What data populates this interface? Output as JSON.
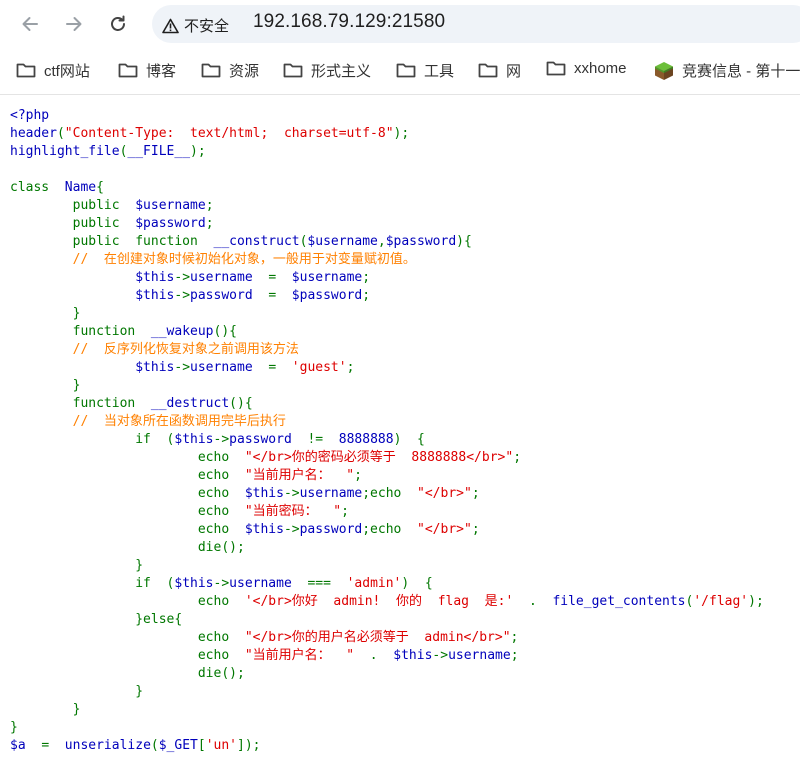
{
  "browser": {
    "security_label": "不安全",
    "url": "192.168.79.129:21580"
  },
  "bookmarks": [
    {
      "label": "ctf网站"
    },
    {
      "label": "博客"
    },
    {
      "label": "资源"
    },
    {
      "label": "形式主义"
    },
    {
      "label": "工具"
    },
    {
      "label": "网"
    },
    {
      "label": "xxhome"
    },
    {
      "label": "竞赛信息 - 第十一"
    }
  ],
  "code_lines": [
    [
      {
        "t": "<?php",
        "c": "b"
      }
    ],
    [
      {
        "t": "header",
        "c": "b"
      },
      {
        "t": "(",
        "c": "k"
      },
      {
        "t": "\"Content-Type:  text/html;  charset=utf-8\"",
        "c": "s"
      },
      {
        "t": ");",
        "c": "k"
      }
    ],
    [
      {
        "t": "highlight_file",
        "c": "b"
      },
      {
        "t": "(",
        "c": "k"
      },
      {
        "t": "__FILE__",
        "c": "b"
      },
      {
        "t": ");",
        "c": "k"
      }
    ],
    [],
    [
      {
        "t": "class  ",
        "c": "k"
      },
      {
        "t": "Name",
        "c": "b"
      },
      {
        "t": "{",
        "c": "k"
      }
    ],
    [
      {
        "t": "        public  ",
        "c": "k"
      },
      {
        "t": "$username",
        "c": "b"
      },
      {
        "t": ";",
        "c": "k"
      }
    ],
    [
      {
        "t": "        public  ",
        "c": "k"
      },
      {
        "t": "$password",
        "c": "b"
      },
      {
        "t": ";",
        "c": "k"
      }
    ],
    [
      {
        "t": "        public  function  ",
        "c": "k"
      },
      {
        "t": "__construct",
        "c": "b"
      },
      {
        "t": "(",
        "c": "k"
      },
      {
        "t": "$username",
        "c": "b"
      },
      {
        "t": ",",
        "c": "k"
      },
      {
        "t": "$password",
        "c": "b"
      },
      {
        "t": "){",
        "c": "k"
      }
    ],
    [
      {
        "t": "        //  在创建对象时候初始化对象，一般用于对变量赋初值。",
        "c": "c"
      }
    ],
    [
      {
        "t": "                ",
        "c": "k"
      },
      {
        "t": "$this",
        "c": "b"
      },
      {
        "t": "->",
        "c": "k"
      },
      {
        "t": "username  ",
        "c": "b"
      },
      {
        "t": "=  ",
        "c": "k"
      },
      {
        "t": "$username",
        "c": "b"
      },
      {
        "t": ";",
        "c": "k"
      }
    ],
    [
      {
        "t": "                ",
        "c": "k"
      },
      {
        "t": "$this",
        "c": "b"
      },
      {
        "t": "->",
        "c": "k"
      },
      {
        "t": "password  ",
        "c": "b"
      },
      {
        "t": "=  ",
        "c": "k"
      },
      {
        "t": "$password",
        "c": "b"
      },
      {
        "t": ";",
        "c": "k"
      }
    ],
    [
      {
        "t": "        }",
        "c": "k"
      }
    ],
    [
      {
        "t": "        function  ",
        "c": "k"
      },
      {
        "t": "__wakeup",
        "c": "b"
      },
      {
        "t": "(){",
        "c": "k"
      }
    ],
    [
      {
        "t": "        //  反序列化恢复对象之前调用该方法",
        "c": "c"
      }
    ],
    [
      {
        "t": "                ",
        "c": "k"
      },
      {
        "t": "$this",
        "c": "b"
      },
      {
        "t": "->",
        "c": "k"
      },
      {
        "t": "username  ",
        "c": "b"
      },
      {
        "t": "=  ",
        "c": "k"
      },
      {
        "t": "'guest'",
        "c": "s"
      },
      {
        "t": ";",
        "c": "k"
      }
    ],
    [
      {
        "t": "        }",
        "c": "k"
      }
    ],
    [
      {
        "t": "        function  ",
        "c": "k"
      },
      {
        "t": "__destruct",
        "c": "b"
      },
      {
        "t": "(){",
        "c": "k"
      }
    ],
    [
      {
        "t": "        //  当对象所在函数调用完毕后执行",
        "c": "c"
      }
    ],
    [
      {
        "t": "                if  (",
        "c": "k"
      },
      {
        "t": "$this",
        "c": "b"
      },
      {
        "t": "->",
        "c": "k"
      },
      {
        "t": "password  ",
        "c": "b"
      },
      {
        "t": "!=  ",
        "c": "k"
      },
      {
        "t": "8888888",
        "c": "b"
      },
      {
        "t": ")  {",
        "c": "k"
      }
    ],
    [
      {
        "t": "                        echo  ",
        "c": "k"
      },
      {
        "t": "\"</br>你的密码必须等于  8888888</br>\"",
        "c": "s"
      },
      {
        "t": ";",
        "c": "k"
      }
    ],
    [
      {
        "t": "                        echo  ",
        "c": "k"
      },
      {
        "t": "\"当前用户名：  \"",
        "c": "s"
      },
      {
        "t": ";",
        "c": "k"
      }
    ],
    [
      {
        "t": "                        echo  ",
        "c": "k"
      },
      {
        "t": "$this",
        "c": "b"
      },
      {
        "t": "->",
        "c": "k"
      },
      {
        "t": "username",
        "c": "b"
      },
      {
        "t": ";echo  ",
        "c": "k"
      },
      {
        "t": "\"</br>\"",
        "c": "s"
      },
      {
        "t": ";",
        "c": "k"
      }
    ],
    [
      {
        "t": "                        echo  ",
        "c": "k"
      },
      {
        "t": "\"当前密码：  \"",
        "c": "s"
      },
      {
        "t": ";",
        "c": "k"
      }
    ],
    [
      {
        "t": "                        echo  ",
        "c": "k"
      },
      {
        "t": "$this",
        "c": "b"
      },
      {
        "t": "->",
        "c": "k"
      },
      {
        "t": "password",
        "c": "b"
      },
      {
        "t": ";echo  ",
        "c": "k"
      },
      {
        "t": "\"</br>\"",
        "c": "s"
      },
      {
        "t": ";",
        "c": "k"
      }
    ],
    [
      {
        "t": "                        die",
        "c": "k"
      },
      {
        "t": "();",
        "c": "k"
      }
    ],
    [
      {
        "t": "                }",
        "c": "k"
      }
    ],
    [
      {
        "t": "                if  (",
        "c": "k"
      },
      {
        "t": "$this",
        "c": "b"
      },
      {
        "t": "->",
        "c": "k"
      },
      {
        "t": "username  ",
        "c": "b"
      },
      {
        "t": "===  ",
        "c": "k"
      },
      {
        "t": "'admin'",
        "c": "s"
      },
      {
        "t": ")  {",
        "c": "k"
      }
    ],
    [
      {
        "t": "                        echo  ",
        "c": "k"
      },
      {
        "t": "'</br>你好  admin!  你的  flag  是:'",
        "c": "s"
      },
      {
        "t": "  .  ",
        "c": "k"
      },
      {
        "t": "file_get_contents",
        "c": "b"
      },
      {
        "t": "(",
        "c": "k"
      },
      {
        "t": "'/flag'",
        "c": "s"
      },
      {
        "t": ");",
        "c": "k"
      }
    ],
    [
      {
        "t": "                }else{",
        "c": "k"
      }
    ],
    [
      {
        "t": "                        echo  ",
        "c": "k"
      },
      {
        "t": "\"</br>你的用户名必须等于  admin</br>\"",
        "c": "s"
      },
      {
        "t": ";",
        "c": "k"
      }
    ],
    [
      {
        "t": "                        echo  ",
        "c": "k"
      },
      {
        "t": "\"当前用户名：  \"",
        "c": "s"
      },
      {
        "t": "  .  ",
        "c": "k"
      },
      {
        "t": "$this",
        "c": "b"
      },
      {
        "t": "->",
        "c": "k"
      },
      {
        "t": "username",
        "c": "b"
      },
      {
        "t": ";",
        "c": "k"
      }
    ],
    [
      {
        "t": "                        die",
        "c": "k"
      },
      {
        "t": "();",
        "c": "k"
      }
    ],
    [
      {
        "t": "                }",
        "c": "k"
      }
    ],
    [
      {
        "t": "        }",
        "c": "k"
      }
    ],
    [
      {
        "t": "}",
        "c": "k"
      }
    ],
    [
      {
        "t": "$a  ",
        "c": "b"
      },
      {
        "t": "=  ",
        "c": "k"
      },
      {
        "t": "unserialize",
        "c": "b"
      },
      {
        "t": "(",
        "c": "k"
      },
      {
        "t": "$_GET",
        "c": "b"
      },
      {
        "t": "[",
        "c": "k"
      },
      {
        "t": "'un'",
        "c": "s"
      },
      {
        "t": "]);",
        "c": "k"
      }
    ]
  ]
}
